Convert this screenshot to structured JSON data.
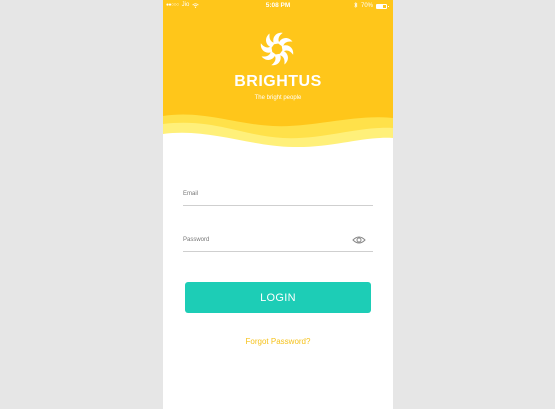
{
  "status_bar": {
    "carrier": "Jio",
    "time": "5:08 PM",
    "battery": "70%",
    "battery_level": 0.7
  },
  "brand": {
    "name": "BRIGHTUS",
    "tagline": "The bright people"
  },
  "form": {
    "email_label": "Email",
    "email_value": "",
    "password_label": "Password",
    "password_value": "",
    "login_label": "LOGIN",
    "forgot_label": "Forgot Password?"
  },
  "colors": {
    "header_yellow": "#ffc61a",
    "accent_teal": "#1dcdb6",
    "link_yellow": "#f6c21b",
    "page_background": "#e6e6e6"
  },
  "icons": {
    "logo": "sun-swirl-icon",
    "password_visibility": "eye-icon",
    "wifi": "wifi-icon",
    "bluetooth": "bluetooth-icon",
    "battery": "battery-icon"
  }
}
